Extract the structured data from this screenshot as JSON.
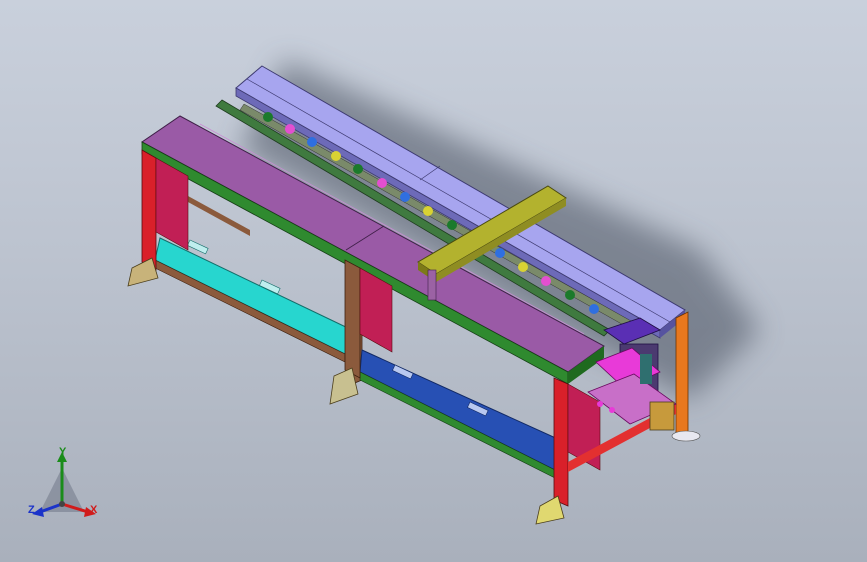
{
  "viewport": {
    "background_top": "#c9d0dc",
    "background_bottom": "#a9b0bc"
  },
  "model": {
    "colors": {
      "top_plate_left": "#9a5aa6",
      "top_plate_right": "#a7a5ef",
      "bridge": "#b3b22e",
      "lower_shelf_left": "#27d6cf",
      "lower_shelf_right": "#2750b4",
      "frame_leg_red": "#d9202a",
      "frame_brown": "#8b5a3c",
      "frame_green": "#2f8a2f",
      "frame_orange": "#e8781e",
      "fixture_magenta": "#e83ad8",
      "fixture_purple": "#5a2fb4"
    }
  },
  "triad": {
    "x_label": "X",
    "y_label": "Y",
    "z_label": "Z",
    "x_color": "#d11b1b",
    "y_color": "#1a8c1a",
    "z_color": "#1b33c9"
  }
}
